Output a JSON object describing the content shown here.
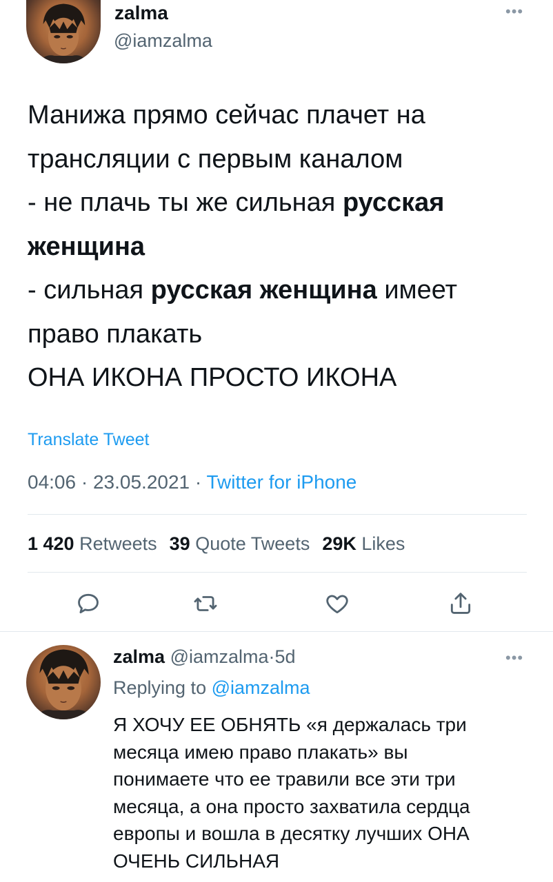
{
  "main_tweet": {
    "author_name": "zalma",
    "author_handle": "@iamzalma",
    "text_lines": [
      [
        {
          "t": "Манижа прямо сейчас плачет на",
          "b": false
        }
      ],
      [
        {
          "t": "трансляции с первым каналом",
          "b": false
        }
      ],
      [
        {
          "t": "- не плачь ты же сильная ",
          "b": false
        },
        {
          "t": "русская",
          "b": true
        }
      ],
      [
        {
          "t": "женщина",
          "b": true
        }
      ],
      [
        {
          "t": "- сильная ",
          "b": false
        },
        {
          "t": "русская женщина",
          "b": true
        },
        {
          "t": " имеет",
          "b": false
        }
      ],
      [
        {
          "t": "право плакать",
          "b": false
        }
      ],
      [
        {
          "t": "ОНА ИКОНА ПРОСТО ИКОНА",
          "b": false
        }
      ]
    ],
    "translate_label": "Translate Tweet",
    "time": "04:06",
    "date": "23.05.2021",
    "source": "Twitter for iPhone",
    "stats": {
      "retweets_count": "1 420",
      "retweets_label": "Retweets",
      "quotes_count": "39",
      "quotes_label": "Quote Tweets",
      "likes_count": "29K",
      "likes_label": "Likes"
    },
    "actions": [
      "reply-icon",
      "retweet-icon",
      "like-icon",
      "share-icon"
    ]
  },
  "reply_tweet": {
    "author_name": "zalma",
    "author_handle": "@iamzalma",
    "age": "5d",
    "replying_prefix": "Replying to",
    "replying_handle": "@iamzalma",
    "text_lines": [
      "Я ХОЧУ ЕЕ ОБНЯТЬ «я держалась три",
      "месяца имею право плакать» вы",
      "понимаете что ее травили все эти три",
      "месяца, а она просто захватила сердца",
      "европы и вошла в десятку лучших ОНА",
      "ОЧЕНЬ СИЛЬНАЯ"
    ]
  },
  "colors": {
    "accent": "#1d9bf0",
    "text": "#0f1419",
    "secondary": "#536471",
    "divider": "#e1e8ed"
  }
}
